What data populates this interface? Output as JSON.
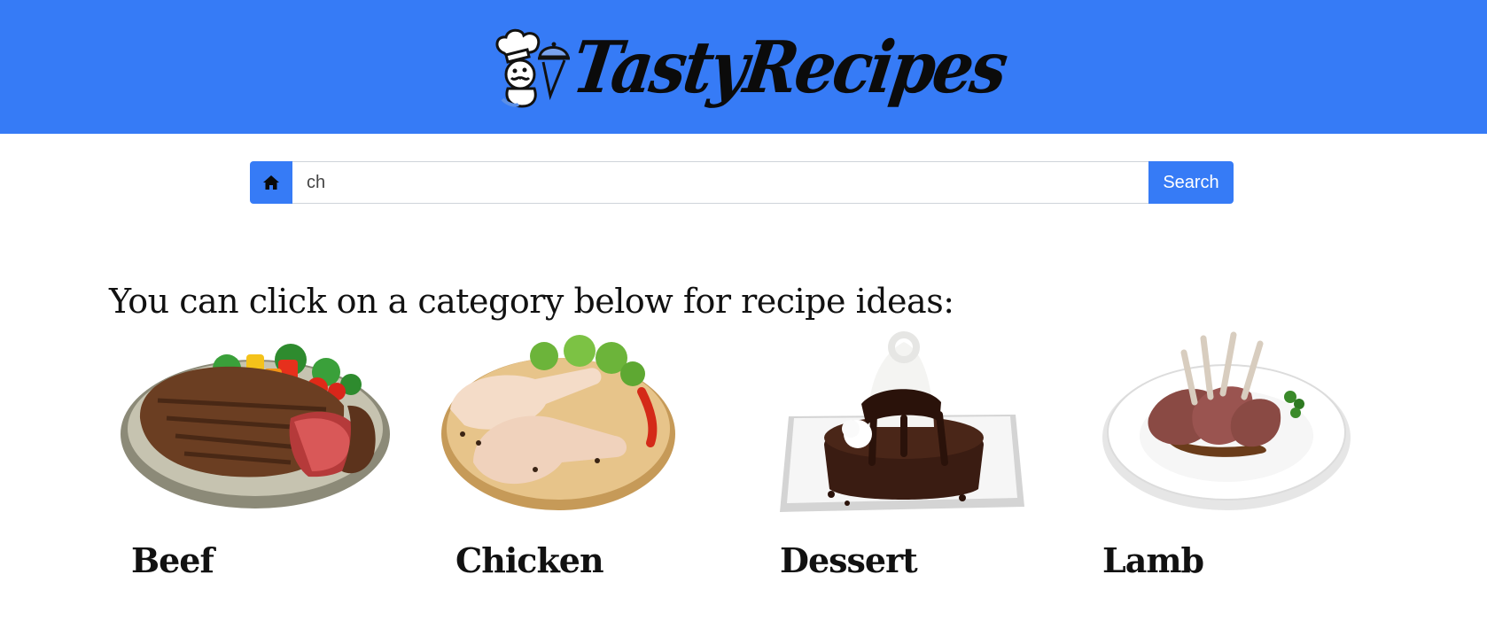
{
  "header": {
    "logo_text": "TastyRecipes",
    "background_color": "#367bf6"
  },
  "search": {
    "home_icon": "home-icon",
    "value": "ch",
    "button_label": "Search"
  },
  "prompt": "You can click on a category below for recipe ideas:",
  "categories": [
    {
      "label": "Beef",
      "image": "beef-steak-plate-image"
    },
    {
      "label": "Chicken",
      "image": "raw-chicken-legs-image"
    },
    {
      "label": "Dessert",
      "image": "chocolate-lava-cake-image"
    },
    {
      "label": "Lamb",
      "image": "lamb-chops-plate-image"
    }
  ]
}
